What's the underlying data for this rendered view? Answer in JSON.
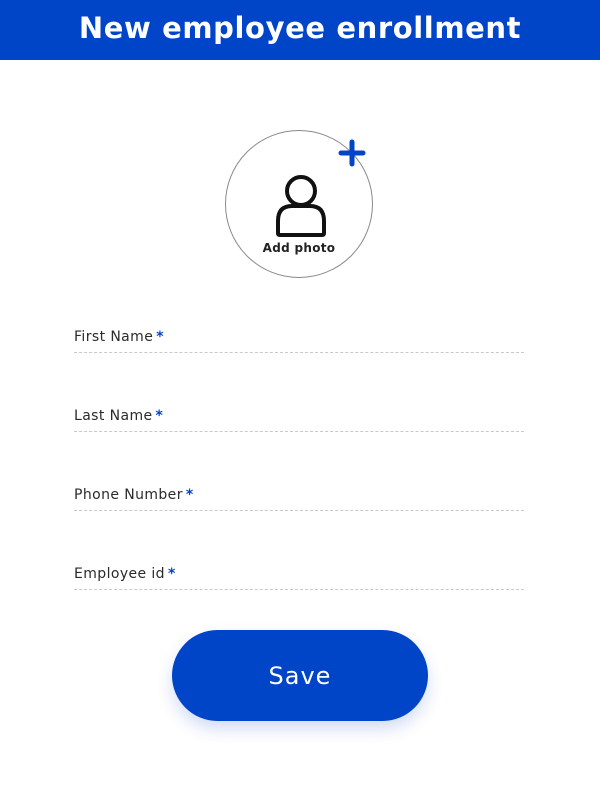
{
  "header": {
    "title": "New employee enrollment",
    "background_color": "#0044c8"
  },
  "photo": {
    "label": "Add photo",
    "icon": "person-icon",
    "add_icon": "plus-icon"
  },
  "form": {
    "required_marker": "*",
    "fields": [
      {
        "label": "First Name",
        "value": ""
      },
      {
        "label": "Last Name",
        "value": ""
      },
      {
        "label": "Phone Number",
        "value": ""
      },
      {
        "label": "Employee id",
        "value": ""
      }
    ]
  },
  "actions": {
    "save_label": "Save",
    "accent_color": "#0044c8"
  }
}
